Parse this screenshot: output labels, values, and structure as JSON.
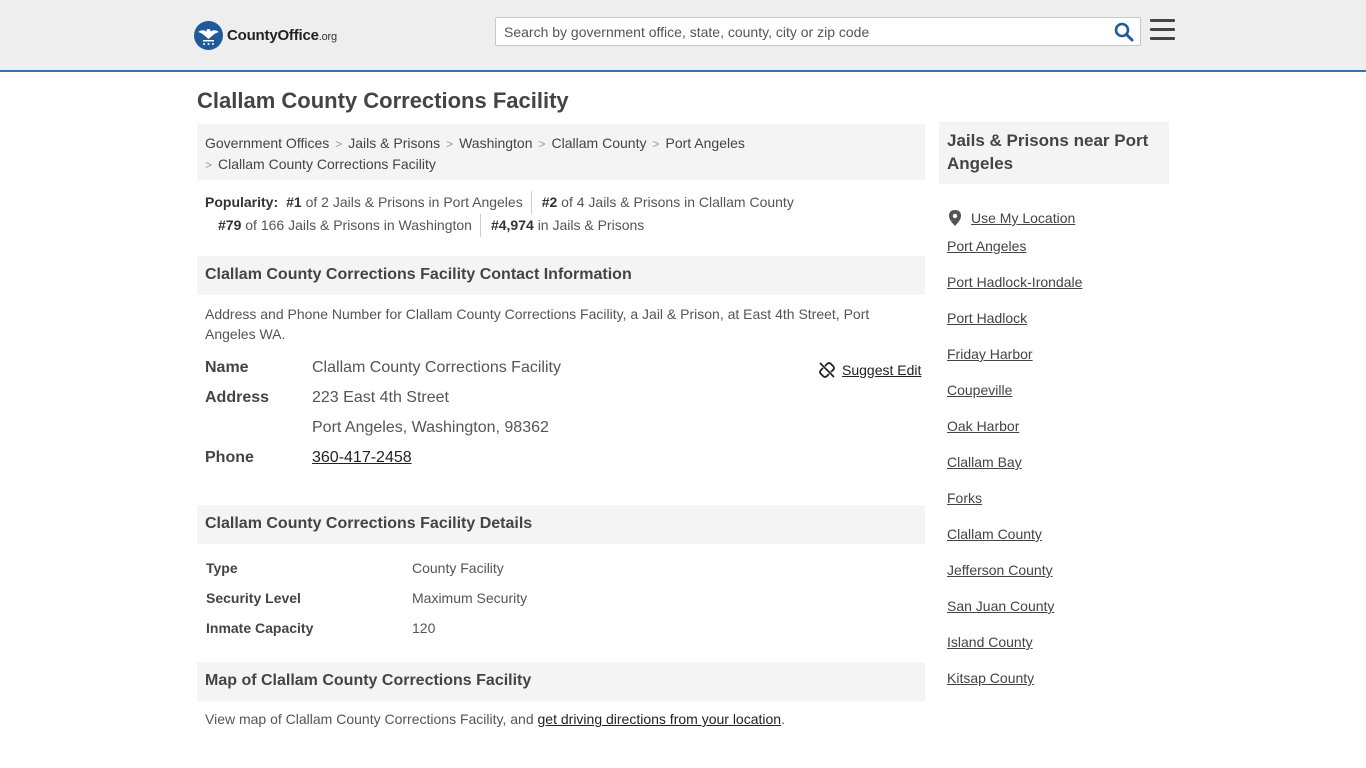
{
  "header": {
    "logo": {
      "brand": "CountyOffice",
      "suffix": ".org",
      "icon": "eagle-logo-icon"
    },
    "search": {
      "placeholder": "Search by government office, state, county, city or zip code",
      "icon": "search-icon"
    },
    "menu_icon": "hamburger-menu-icon"
  },
  "page": {
    "title": "Clallam County Corrections Facility"
  },
  "breadcrumb": [
    "Government Offices",
    "Jails & Prisons",
    "Washington",
    "Clallam County",
    "Port Angeles",
    "Clallam County Corrections Facility"
  ],
  "popularity": {
    "label": "Popularity:",
    "items": [
      {
        "rank": "#1",
        "text": "of 2 Jails & Prisons in Port Angeles"
      },
      {
        "rank": "#2",
        "text": "of 4 Jails & Prisons in Clallam County"
      },
      {
        "rank": "#79",
        "text": "of 166 Jails & Prisons in Washington"
      },
      {
        "rank": "#4,974",
        "text": "in Jails & Prisons"
      }
    ]
  },
  "contact": {
    "heading": "Clallam County Corrections Facility Contact Information",
    "description": "Address and Phone Number for Clallam County Corrections Facility, a Jail & Prison, at East 4th Street, Port Angeles WA.",
    "suggest_edit": "Suggest Edit",
    "name_label": "Name",
    "name": "Clallam County Corrections Facility",
    "address_label": "Address",
    "address_line1": "223 East 4th Street",
    "address_line2": "Port Angeles, Washington, 98362",
    "phone_label": "Phone",
    "phone": "360-417-2458"
  },
  "details": {
    "heading": "Clallam County Corrections Facility Details",
    "rows": [
      {
        "label": "Type",
        "value": "County Facility"
      },
      {
        "label": "Security Level",
        "value": "Maximum Security"
      },
      {
        "label": "Inmate Capacity",
        "value": "120"
      }
    ]
  },
  "map": {
    "heading": "Map of Clallam County Corrections Facility",
    "text": "View map of Clallam County Corrections Facility, and",
    "link": "get driving directions from your location",
    "end": "."
  },
  "sidebar": {
    "heading": "Jails & Prisons near Port Angeles",
    "use_location": "Use My Location",
    "links": [
      "Port Angeles",
      "Port Hadlock-Irondale",
      "Port Hadlock",
      "Friday Harbor",
      "Coupeville",
      "Oak Harbor",
      "Clallam Bay",
      "Forks",
      "Clallam County",
      "Jefferson County",
      "San Juan County",
      "Island County",
      "Kitsap County"
    ]
  },
  "colors": {
    "header_bg": "#eeeeee",
    "header_border": "#3b6fb0",
    "logo_blue": "#1f5a9a",
    "search_icon": "#1f5a9a",
    "panel_bg": "#f4f4f4"
  }
}
